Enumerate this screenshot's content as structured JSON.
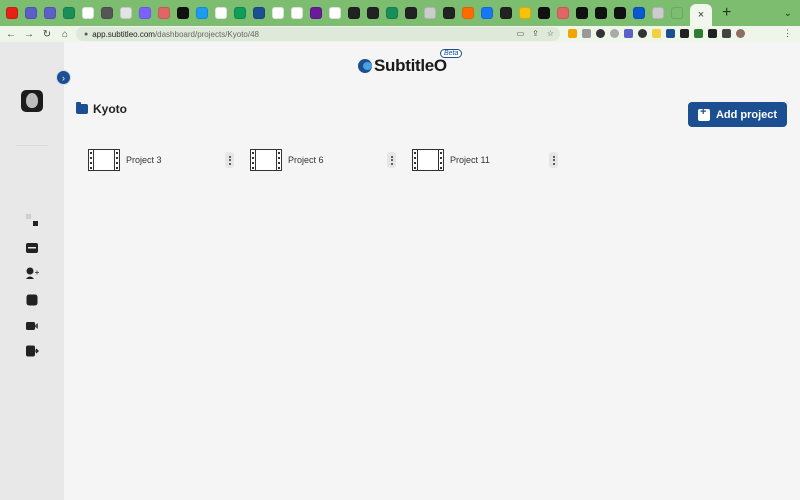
{
  "browser": {
    "active_tab_close": "×",
    "new_tab": "+",
    "tab_list": "⌄",
    "url_domain": "app.subtitleo.com",
    "url_path": "/dashboard/projects/Kyoto/48",
    "tab_favicon_colors": [
      "#e62117",
      "#5b5fc7",
      "#5b5fc7",
      "#1a8e58",
      "#ffffff",
      "#555555",
      "#e3e3e3",
      "#7b61ff",
      "#e06666",
      "#111111",
      "#1d9bf0",
      "#ffffff",
      "#0f9d58",
      "#1b4f91",
      "#ffffff",
      "#ffffff",
      "#6a1b9a",
      "#ffffff",
      "#222222",
      "#222222",
      "#1a8e58",
      "#222222",
      "#cccccc",
      "#222222",
      "#ff6d00",
      "#1877f2",
      "#222222",
      "#f4c20d",
      "#111111",
      "#e06666",
      "#111111",
      "#111111",
      "#111111",
      "#0b57d0",
      "#cccccc",
      "#7dbd6f"
    ]
  },
  "app": {
    "logo_text": "SubtitleO",
    "beta_label": "Beta",
    "folder_name": "Kyoto",
    "add_project_label": "Add project",
    "projects": [
      {
        "name": "Project 3"
      },
      {
        "name": "Project 6"
      },
      {
        "name": "Project 11"
      }
    ],
    "sidebar_nav": [
      "dashboard-icon",
      "folder-icon",
      "add-user-icon",
      "square-icon",
      "video-icon",
      "logout-icon"
    ],
    "accent_color": "#1b4f91"
  }
}
